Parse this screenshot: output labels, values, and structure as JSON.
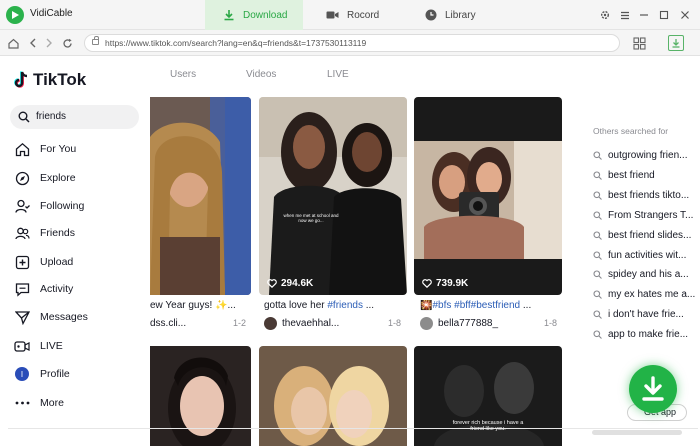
{
  "app": {
    "name": "VidiCable"
  },
  "modes": {
    "download": "Download",
    "record": "Rocord",
    "library": "Library"
  },
  "url": "https://www.tiktok.com/search?lang=en&q=friends&t=1737530113119",
  "brand": "TikTok",
  "search": {
    "value": "friends"
  },
  "nav": [
    {
      "label": "For You",
      "icon": "home-icon"
    },
    {
      "label": "Explore",
      "icon": "compass-icon"
    },
    {
      "label": "Following",
      "icon": "following-icon"
    },
    {
      "label": "Friends",
      "icon": "friends-icon"
    },
    {
      "label": "Upload",
      "icon": "upload-icon"
    },
    {
      "label": "Activity",
      "icon": "activity-icon"
    },
    {
      "label": "Messages",
      "icon": "messages-icon"
    },
    {
      "label": "LIVE",
      "icon": "live-icon"
    },
    {
      "label": "Profile",
      "icon": "profile-avatar"
    },
    {
      "label": "More",
      "icon": "more-icon"
    }
  ],
  "profile_initial": "I",
  "content_tabs": [
    "Users",
    "Videos",
    "LIVE"
  ],
  "videos": [
    {
      "caption": "ew Year guys! ✨...",
      "author": "dss.cli...",
      "count": "1-2",
      "likes": ""
    },
    {
      "caption_text": "gotta love her ",
      "caption_tag": "#friends",
      "caption_rest": " ...",
      "author": "thevaehhal...",
      "count": "1-8",
      "likes": "294.6K",
      "overlay": "when me met at school and now we go..."
    },
    {
      "caption_prefix": "🎇",
      "caption_tag": "#bfs #bff#bestfriend",
      "caption_rest": " ...",
      "author": "bella777888_",
      "count": "1-8",
      "likes": "739.9K"
    }
  ],
  "row2_overlay": "forever rich because i have a friend like you.",
  "others_title": "Others searched for",
  "suggestions": [
    "outgrowing frien...",
    "best friend",
    "best friends tikto...",
    "From Strangers T...",
    "best friend slides...",
    "fun activities wit...",
    "spidey and his a...",
    "my ex hates me a...",
    "i don't have frie...",
    "app to make frie..."
  ],
  "get_app": "Get app",
  "colors": {
    "accent": "#22b347",
    "tag": "#2b5db6",
    "active_tab_bg": "#dff2df"
  }
}
